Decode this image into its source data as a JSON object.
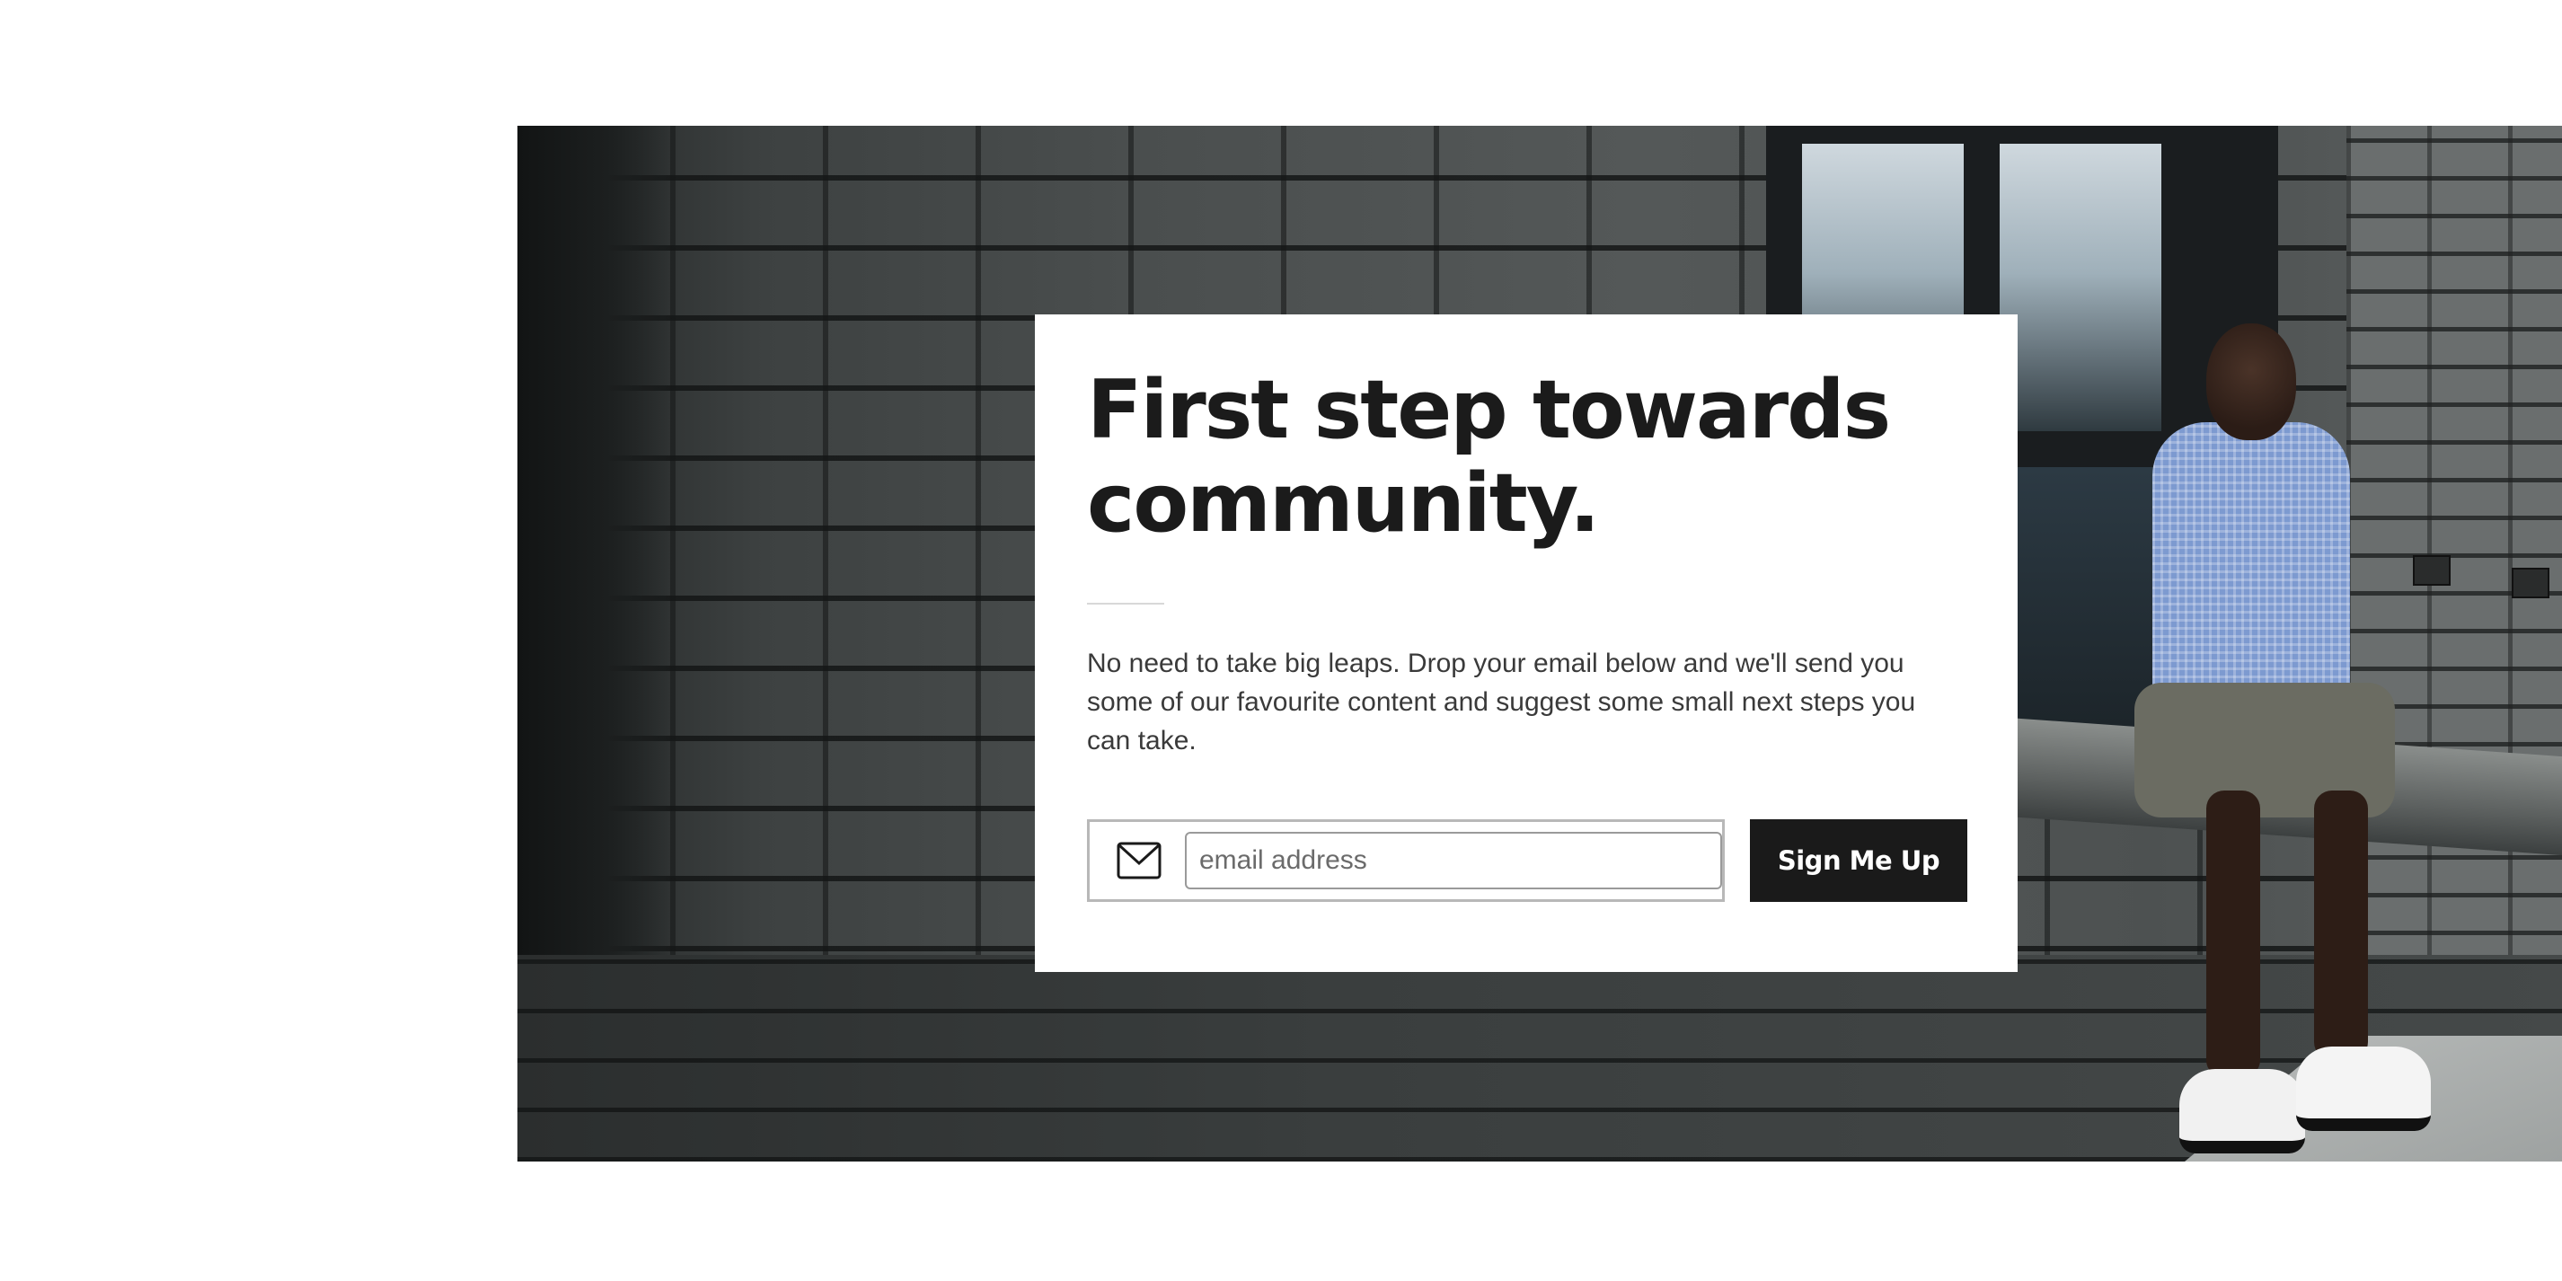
{
  "hero": {
    "image_description_icon": "photo-of-man-sitting-on-brick-ledge"
  },
  "card": {
    "headline": "First step towards community.",
    "description": "No need to take big leaps. Drop your email below and we'll send you some of our favourite content and suggest some small next steps you can take.",
    "email": {
      "icon": "mail-icon",
      "placeholder": "email address",
      "value": ""
    },
    "button_label": "Sign Me Up"
  },
  "colors": {
    "button_background": "#1a1a1a",
    "button_text": "#ffffff",
    "headline": "#1b1b1b",
    "body_text": "#3a3a3a",
    "card_background": "#ffffff"
  }
}
